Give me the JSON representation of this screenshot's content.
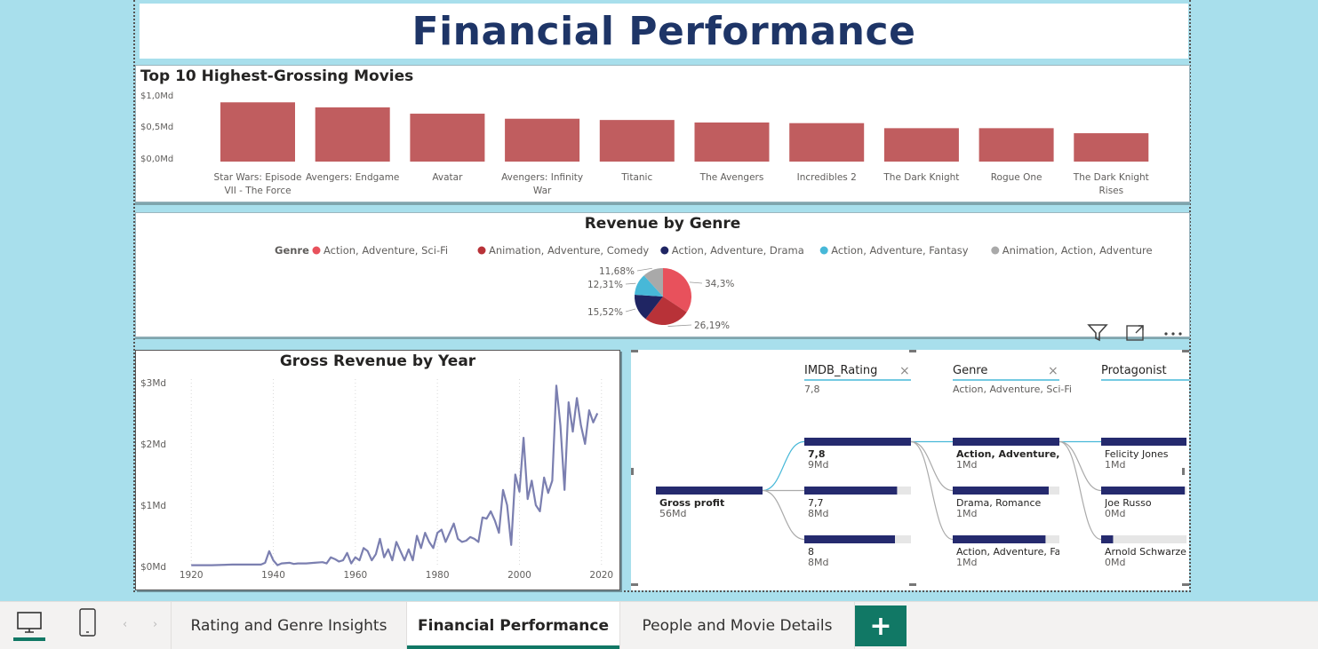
{
  "report": {
    "title": "Financial Performance"
  },
  "bar_chart": {
    "title": "Top 10 Highest-Grossing Movies",
    "y_ticks": [
      "$1,0Md",
      "$0,5Md",
      "$0,0Md"
    ],
    "bar_color": "#c05d5f"
  },
  "pie_chart": {
    "title": "Revenue by Genre",
    "legend_title": "Genre"
  },
  "line_chart": {
    "title": "Gross Revenue by Year",
    "line_color": "#7b7fb0"
  },
  "decomposition_tree": {
    "levels": [
      {
        "header": "IMDB_Rating",
        "selected": "7,8"
      },
      {
        "header": "Genre",
        "selected": "Action, Adventure, Sci-Fi"
      },
      {
        "header": "Protagonist",
        "selected": ""
      }
    ],
    "root": {
      "label": "Gross profit",
      "value": "56Md"
    },
    "columns": [
      [
        {
          "label": "7,8",
          "value": "9Md",
          "bold": true,
          "fill": 1.0
        },
        {
          "label": "7,7",
          "value": "8Md",
          "bold": false,
          "fill": 0.87
        },
        {
          "label": "8",
          "value": "8Md",
          "bold": false,
          "fill": 0.85
        }
      ],
      [
        {
          "label": "Action, Adventure, S...",
          "value": "1Md",
          "bold": true,
          "fill": 1.0
        },
        {
          "label": "Drama, Romance",
          "value": "1Md",
          "bold": false,
          "fill": 0.9
        },
        {
          "label": "Action, Adventure, Fan...",
          "value": "1Md",
          "bold": false,
          "fill": 0.87
        }
      ],
      [
        {
          "label": "Felicity Jones",
          "value": "1Md",
          "bold": false,
          "fill": 1.0
        },
        {
          "label": "Joe Russo",
          "value": "0Md",
          "bold": false,
          "fill": 0.98
        },
        {
          "label": "Arnold Schwarzenegger",
          "value": "0Md",
          "bold": false,
          "fill": 0.14
        }
      ]
    ],
    "bar_color": "#252a6e"
  },
  "tabs": [
    {
      "label": "Rating and Genre Insights",
      "active": false
    },
    {
      "label": "Financial Performance",
      "active": true
    },
    {
      "label": "People and Movie Details",
      "active": false
    }
  ],
  "add_tab_label": "+",
  "chart_data": [
    {
      "type": "bar",
      "title": "Top 10 Highest-Grossing Movies",
      "categories": [
        "Star Wars: Episode VII - The Force Aw...",
        "Avengers: Endgame",
        "Avatar",
        "Avengers: Infinity War",
        "Titanic",
        "The Avengers",
        "Incredibles 2",
        "The Dark Knight",
        "Rogue One",
        "The Dark Knight Rises"
      ],
      "values": [
        0.94,
        0.86,
        0.76,
        0.68,
        0.66,
        0.62,
        0.61,
        0.53,
        0.53,
        0.45
      ],
      "ylim": [
        0,
        1.0
      ],
      "y_unit": "Md"
    },
    {
      "type": "pie",
      "title": "Revenue by Genre",
      "legend_title": "Genre",
      "legend_position": "top",
      "slices": [
        {
          "label": "Action, Adventure, Sci-Fi",
          "value": 34.3,
          "display": "34,3%",
          "color": "#e8515c"
        },
        {
          "label": "Animation, Adventure, Comedy",
          "value": 26.19,
          "display": "26,19%",
          "color": "#b83238"
        },
        {
          "label": "Action, Adventure, Drama",
          "value": 15.52,
          "display": "15,52%",
          "color": "#1f2563"
        },
        {
          "label": "Action, Adventure, Fantasy",
          "value": 12.31,
          "display": "12,31%",
          "color": "#47b8d8"
        },
        {
          "label": "Animation, Action, Adventure",
          "value": 11.68,
          "display": "11,68%",
          "color": "#a9a9a9"
        }
      ]
    },
    {
      "type": "line",
      "title": "Gross Revenue by Year",
      "x_ticks": [
        "1920",
        "1940",
        "1960",
        "1980",
        "2000",
        "2020"
      ],
      "y_ticks": [
        "$3Md",
        "$2Md",
        "$1Md",
        "$0Md"
      ],
      "xlim": [
        1918,
        2022
      ],
      "ylim": [
        0,
        3
      ],
      "grid": "vertical dotted",
      "x": [
        1920,
        1925,
        1930,
        1934,
        1937,
        1938,
        1939,
        1940,
        1941,
        1942,
        1944,
        1945,
        1946,
        1948,
        1950,
        1952,
        1953,
        1954,
        1955,
        1956,
        1957,
        1958,
        1959,
        1960,
        1961,
        1962,
        1963,
        1964,
        1965,
        1966,
        1967,
        1968,
        1969,
        1970,
        1971,
        1972,
        1973,
        1974,
        1975,
        1976,
        1977,
        1978,
        1979,
        1980,
        1981,
        1982,
        1983,
        1984,
        1985,
        1986,
        1987,
        1988,
        1989,
        1990,
        1991,
        1992,
        1993,
        1994,
        1995,
        1996,
        1997,
        1998,
        1999,
        2000,
        2001,
        2002,
        2003,
        2004,
        2005,
        2006,
        2007,
        2008,
        2009,
        2010,
        2011,
        2012,
        2013,
        2014,
        2015,
        2016,
        2017,
        2018,
        2019
      ],
      "y": [
        0.02,
        0.02,
        0.03,
        0.03,
        0.03,
        0.06,
        0.25,
        0.1,
        0.02,
        0.05,
        0.06,
        0.04,
        0.05,
        0.05,
        0.06,
        0.07,
        0.05,
        0.15,
        0.12,
        0.08,
        0.1,
        0.22,
        0.05,
        0.15,
        0.1,
        0.3,
        0.25,
        0.1,
        0.2,
        0.45,
        0.15,
        0.28,
        0.1,
        0.4,
        0.25,
        0.1,
        0.28,
        0.1,
        0.5,
        0.3,
        0.55,
        0.4,
        0.3,
        0.55,
        0.6,
        0.4,
        0.55,
        0.7,
        0.45,
        0.4,
        0.42,
        0.48,
        0.45,
        0.4,
        0.8,
        0.78,
        0.9,
        0.75,
        0.55,
        1.25,
        1.0,
        0.35,
        1.5,
        1.22,
        2.1,
        1.1,
        1.4,
        1.0,
        0.9,
        1.45,
        1.2,
        1.4,
        2.95,
        2.3,
        1.25,
        2.68,
        2.2,
        2.75,
        2.3,
        2.0,
        2.55,
        2.35,
        2.5
      ]
    }
  ]
}
